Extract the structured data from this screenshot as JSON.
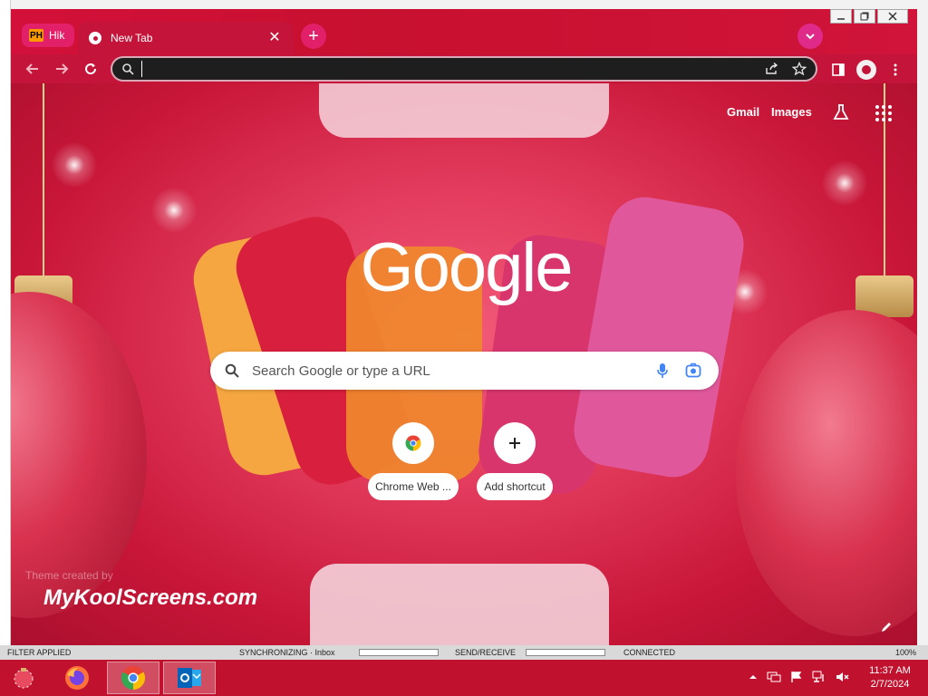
{
  "browser": {
    "profile_chip": {
      "logo": "PH",
      "label": "Hik"
    },
    "tab": {
      "title": "New Tab",
      "icon": "chrome-icon",
      "close": "✕"
    },
    "new_tab": "+",
    "omnibox": {
      "value": "",
      "placeholder": ""
    }
  },
  "ntp": {
    "links": {
      "gmail": "Gmail",
      "images": "Images"
    },
    "logo": "Google",
    "search_placeholder": "Search Google or type a URL",
    "shortcuts": [
      {
        "label": "Chrome Web ...",
        "icon": "chrome-web-store-icon"
      },
      {
        "label": "Add shortcut",
        "icon": "plus-icon"
      }
    ],
    "theme_credit": "Theme created by",
    "watermark": "MyKoolScreens.com"
  },
  "statusbar": {
    "filter": "FILTER APPLIED",
    "sync": "SYNCHRONIZING · Inbox",
    "send_receive": "SEND/RECEIVE",
    "connected": "CONNECTED",
    "zoom": "100%"
  },
  "taskbar": {
    "time": "11:37 AM",
    "date": "2/7/2024"
  },
  "colors": {
    "theme_primary": "#c0122e",
    "theme_accent": "#e2206a",
    "omnibox_bg": "#1e1e1e"
  }
}
